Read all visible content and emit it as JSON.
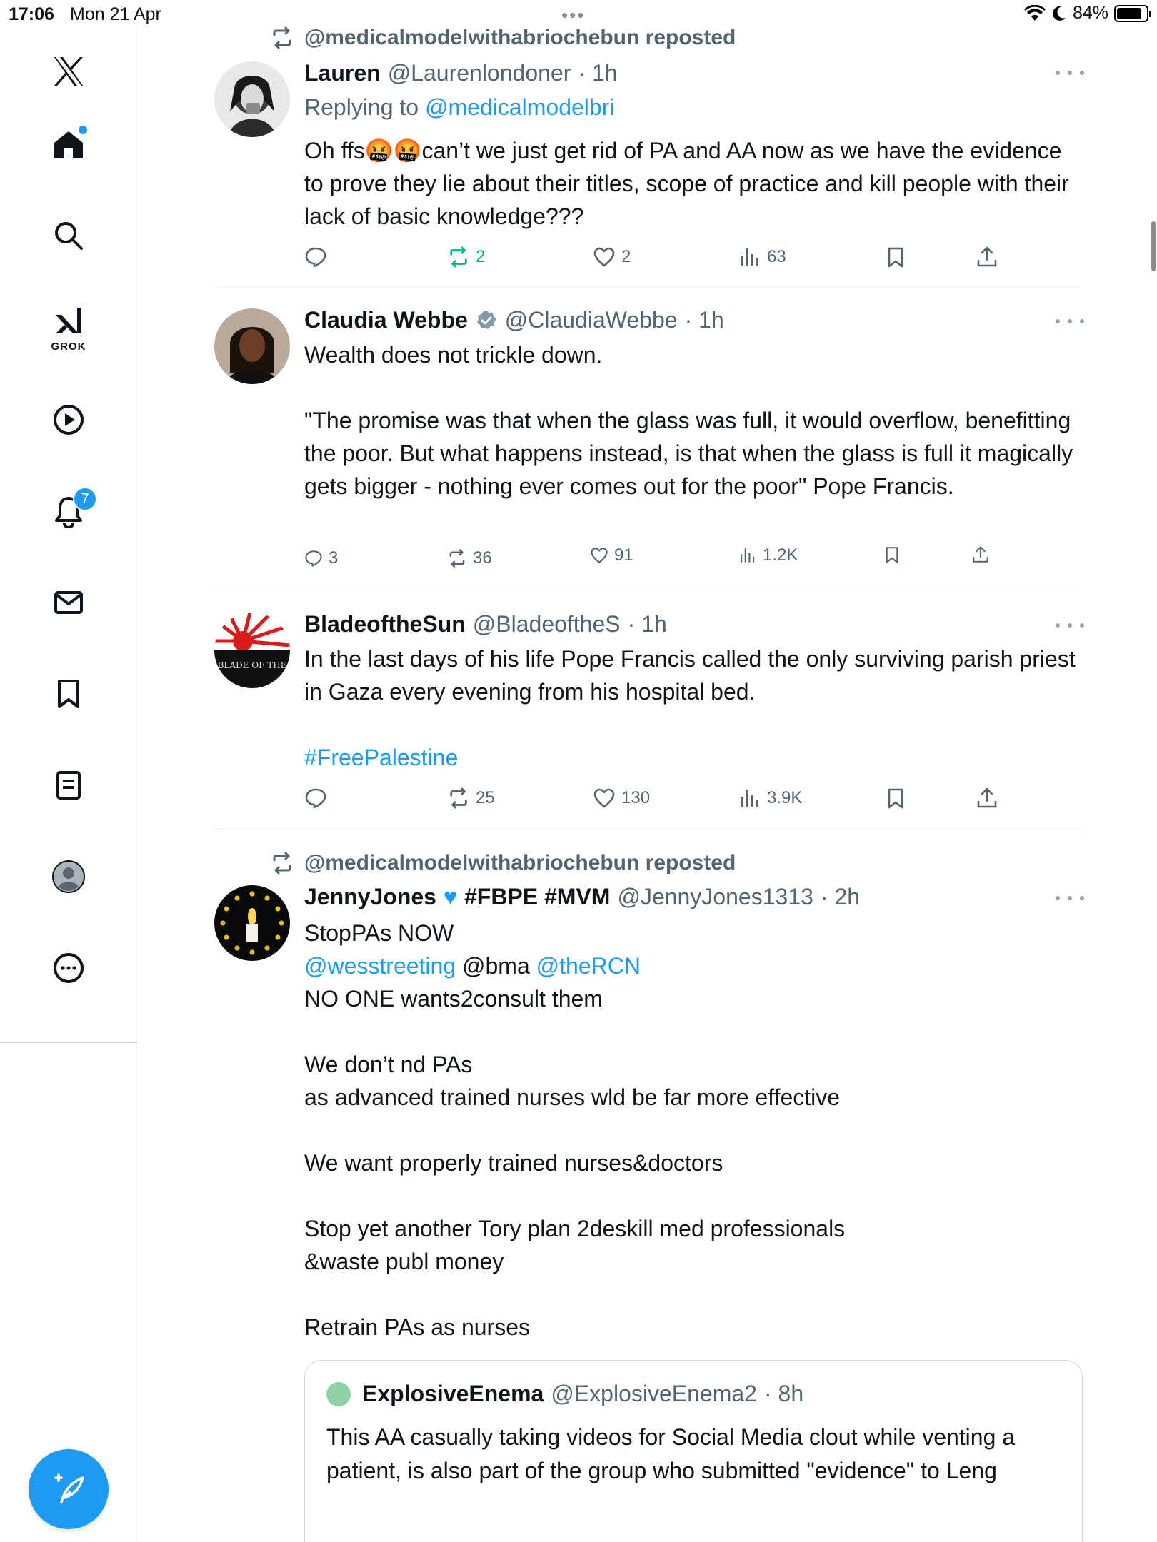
{
  "status_bar": {
    "time": "17:06",
    "date": "Mon 21 Apr",
    "battery": "84%"
  },
  "sidebar": {
    "notification_count": "7",
    "grok_label": "GROK"
  },
  "tweets": [
    {
      "repost_by": "@medicalmodelwithabriochebun reposted",
      "name": "Lauren",
      "handle": "@Laurenlondoner",
      "time": "· 1h",
      "replying_prefix": "Replying to ",
      "replying_to": "@medicalmodelbri",
      "body": "Oh ffs🤬🤬can’t we just get rid of PA and AA now as we have the evidence to prove they lie about their titles, scope of practice and kill people with their lack of basic knowledge???",
      "replies": "",
      "reposts": "2",
      "likes": "2",
      "views": "63"
    },
    {
      "name": "Claudia Webbe",
      "handle": "@ClaudiaWebbe",
      "time": "· 1h",
      "body": "Wealth does not trickle down.\n\n\"The promise was that when the glass was full, it would overflow, benefitting the poor. But what happens instead, is that when the glass is full it magically gets bigger - nothing ever comes out for the poor\" Pope Francis.",
      "replies": "3",
      "reposts": "36",
      "likes": "91",
      "views": "1.2K"
    },
    {
      "name": "BladeoftheSun",
      "handle": "@BladeoftheS",
      "time": "· 1h",
      "body": "In the last days of his life Pope Francis called the only surviving parish priest in Gaza every evening from his hospital bed.",
      "hashtag": "#FreePalestine",
      "replies": "",
      "reposts": "25",
      "likes": "130",
      "views": "3.9K",
      "avatar_text": "BLADE OF THE"
    },
    {
      "repost_by": "@medicalmodelwithabriochebun reposted",
      "name": "JennyJones",
      "name_suffix": "#FBPE #MVM",
      "handle": "@JennyJones1313",
      "time": "· 2h",
      "line1": "StopPAs NOW",
      "mention1": "@wesstreeting",
      "mention2": " @bma ",
      "mention3": "@theRCN",
      "rest": "NO ONE wants2consult them\n\nWe don’t nd PAs\nas advanced trained nurses wld be far more effective\n\nWe want properly trained nurses&doctors\n\nStop yet another Tory plan 2deskill med professionals\n&waste publ money\n\nRetrain PAs as nurses"
    }
  ],
  "quote": {
    "name": "ExplosiveEnema",
    "handle": "@ExplosiveEnema2",
    "time": "· 8h",
    "body": "This AA casually taking videos for Social Media clout while venting a patient, is also part of the group who submitted \"evidence\" to Leng"
  },
  "colors": {
    "accent": "#1d9bf0",
    "repost_green": "#00ba7c",
    "muted": "#536471"
  }
}
